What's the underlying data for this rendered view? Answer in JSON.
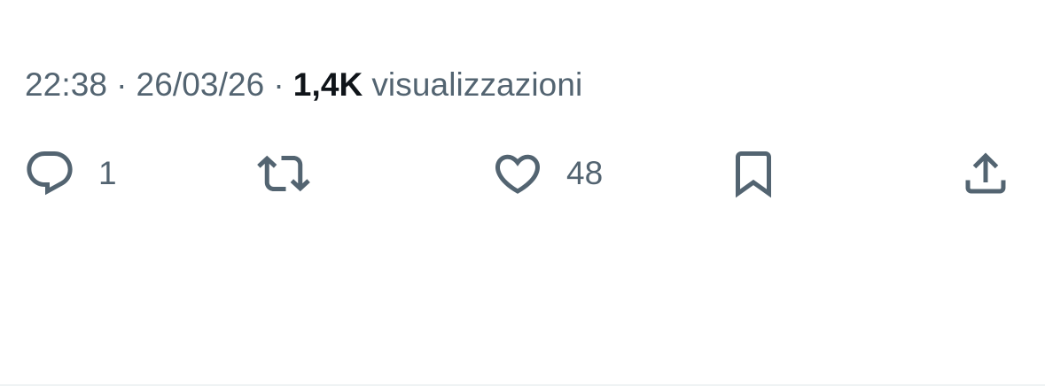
{
  "tweet_meta": {
    "time": "22:38",
    "separator": "·",
    "date": "26/03/26",
    "views_count": "1,4K",
    "views_label": "visualizzazioni"
  },
  "actions": {
    "reply": {
      "icon": "reply-icon",
      "count": "1"
    },
    "retweet": {
      "icon": "retweet-icon",
      "count": ""
    },
    "like": {
      "icon": "heart-icon",
      "count": "48"
    },
    "bookmark": {
      "icon": "bookmark-icon"
    },
    "share": {
      "icon": "share-icon"
    }
  },
  "colors": {
    "secondary_text": "#536471",
    "primary_text": "#0f1419",
    "divider": "#eff3f4",
    "background": "#ffffff"
  }
}
